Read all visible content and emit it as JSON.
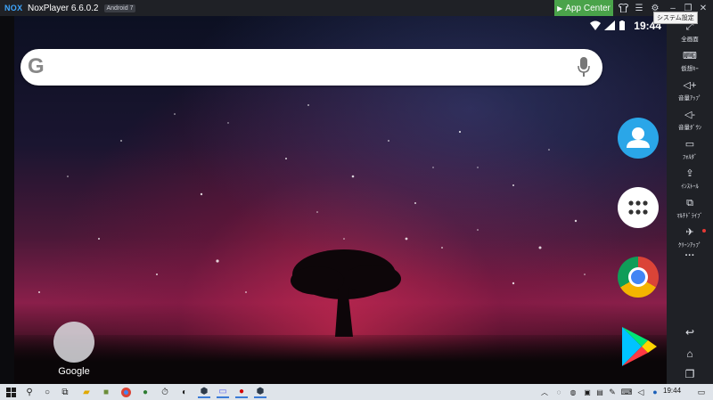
{
  "window": {
    "logo_text": "NOX",
    "title": "NoxPlayer 6.6.0.2",
    "android_badge": "Android 7",
    "app_center_label": "App Center",
    "tooltip": "システム設定"
  },
  "status_bar": {
    "time": "19:44"
  },
  "search": {
    "logo_letter": "G"
  },
  "home": {
    "folder_label": "Google",
    "dock_apps": [
      "contacts",
      "app-drawer",
      "chrome",
      "play-store"
    ]
  },
  "sidebar": {
    "items": [
      {
        "id": "fullscreen",
        "label": "全画面",
        "icon": "⤢"
      },
      {
        "id": "virtual-key",
        "label": "仮想ｷｰ",
        "icon": "⌨"
      },
      {
        "id": "volume-up",
        "label": "音量ｱｯﾌﾟ",
        "icon": "◁+"
      },
      {
        "id": "volume-down",
        "label": "音量ﾀﾞｳﾝ",
        "icon": "◁-"
      },
      {
        "id": "folder",
        "label": "ﾌｫﾙﾀﾞ",
        "icon": "▭"
      },
      {
        "id": "install",
        "label": "ｲﾝｽﾄｰﾙ",
        "icon": "⇪"
      },
      {
        "id": "multi-drive",
        "label": "ﾏﾙﾁﾄﾞﾗｲﾌﾞ",
        "icon": "⧉"
      },
      {
        "id": "cleanup",
        "label": "ｸﾘｰﾝｱｯﾌﾟ",
        "icon": "✈"
      }
    ],
    "more": "···",
    "nav": {
      "back": "↩",
      "home": "⌂",
      "recents": "❐"
    }
  },
  "taskbar": {
    "time": "19:44"
  },
  "colors": {
    "app_center": "#4aa34a",
    "chrome_bar": "#1f2126",
    "taskbar": "#dfe4ea"
  }
}
